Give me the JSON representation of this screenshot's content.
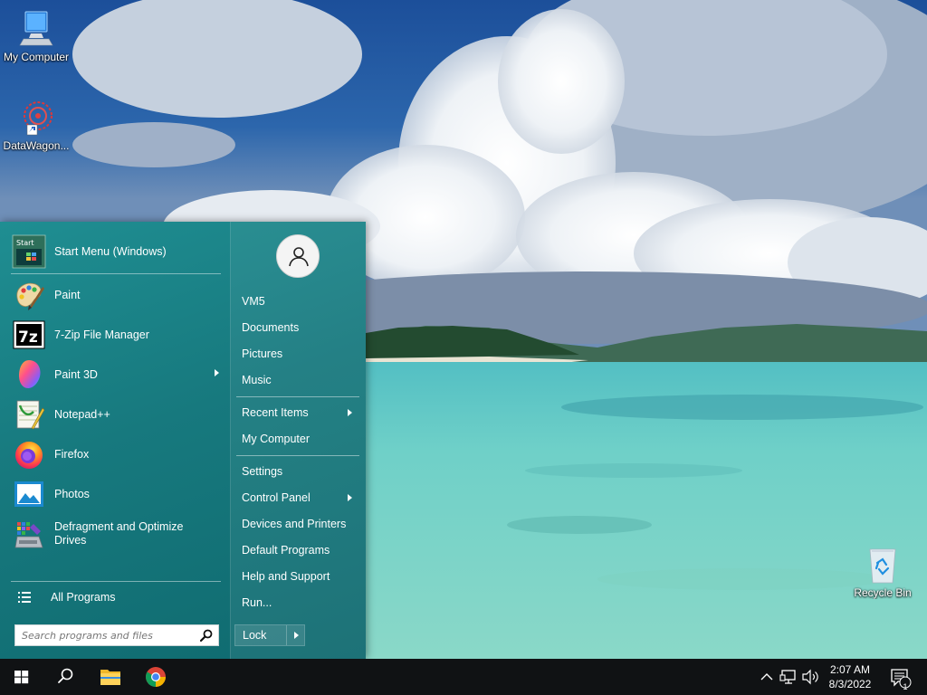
{
  "desktop": {
    "icons": [
      {
        "label": "My Computer",
        "icon": "monitor-icon"
      },
      {
        "label": "DataWagon...",
        "icon": "datawagon-icon"
      },
      {
        "label": "Recycle Bin",
        "icon": "recycle-bin-icon"
      }
    ]
  },
  "start_menu": {
    "pinned": [
      {
        "label": "Start Menu (Windows)",
        "icon": "start-menu-icon"
      }
    ],
    "programs": [
      {
        "label": "Paint",
        "icon": "paint-icon",
        "submenu": false
      },
      {
        "label": "7-Zip File Manager",
        "icon": "7zip-icon",
        "submenu": false
      },
      {
        "label": "Paint 3D",
        "icon": "paint3d-icon",
        "submenu": true
      },
      {
        "label": "Notepad++",
        "icon": "notepadpp-icon",
        "submenu": false
      },
      {
        "label": "Firefox",
        "icon": "firefox-icon",
        "submenu": false
      },
      {
        "label": "Photos",
        "icon": "photos-icon",
        "submenu": false
      },
      {
        "label": "Defragment and Optimize Drives",
        "icon": "defrag-icon",
        "submenu": false
      }
    ],
    "all_programs_label": "All Programs",
    "search_placeholder": "Search programs and files",
    "user_name": "VM5",
    "places": [
      {
        "label": "Documents"
      },
      {
        "label": "Pictures"
      },
      {
        "label": "Music"
      }
    ],
    "places2": [
      {
        "label": "Recent Items",
        "submenu": true
      },
      {
        "label": "My Computer",
        "submenu": false
      }
    ],
    "system": [
      {
        "label": "Settings",
        "submenu": false
      },
      {
        "label": "Control Panel",
        "submenu": true
      },
      {
        "label": "Devices and Printers",
        "submenu": false
      },
      {
        "label": "Default Programs",
        "submenu": false
      },
      {
        "label": "Help and Support",
        "submenu": false
      },
      {
        "label": "Run...",
        "submenu": false
      }
    ],
    "lock_label": "Lock",
    "start_tile_text": "Start"
  },
  "taskbar": {
    "buttons": [
      "start-button",
      "search-button",
      "file-explorer-button",
      "chrome-button"
    ],
    "clock_time": "2:07 AM",
    "clock_date": "8/3/2022",
    "notification_count": "1"
  },
  "colors": {
    "menu_bg": "#17797e",
    "taskbar_bg": "#101214",
    "accent_blue": "#1d8fe0"
  }
}
